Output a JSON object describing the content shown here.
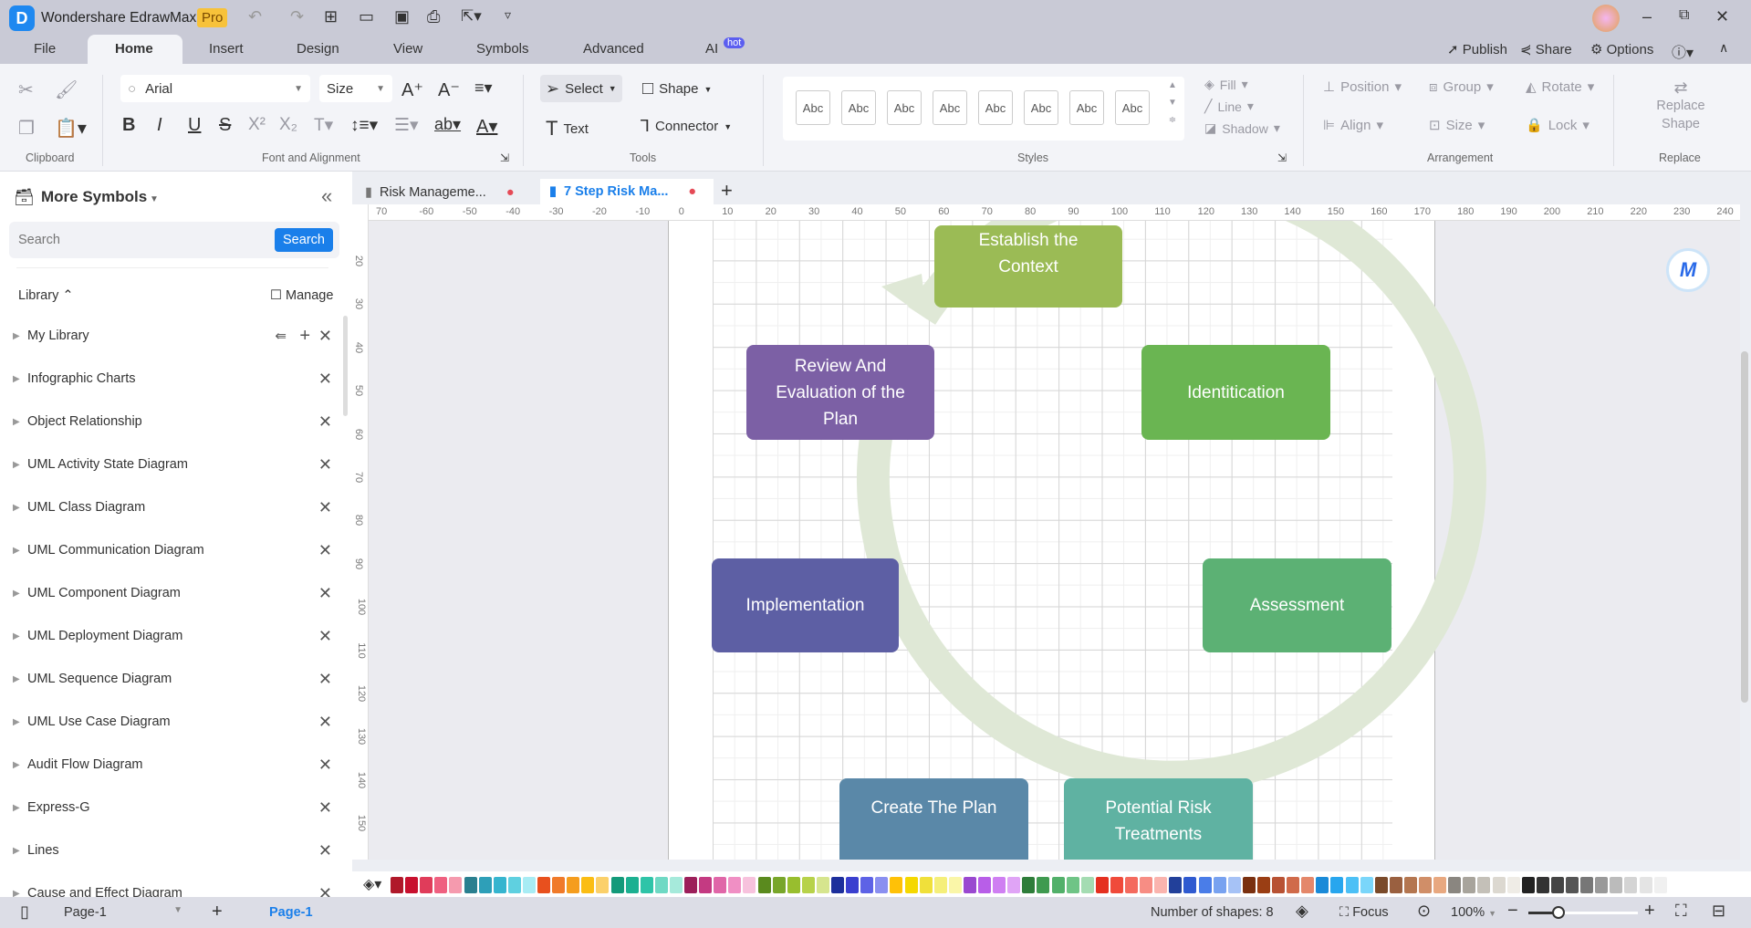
{
  "app": {
    "title": "Wondershare EdrawMax",
    "badge": "Pro",
    "ai_badge": "hot"
  },
  "menu": [
    "File",
    "Home",
    "Insert",
    "Design",
    "View",
    "Symbols",
    "Advanced",
    "AI"
  ],
  "header_actions": {
    "publish": "Publish",
    "share": "Share",
    "options": "Options"
  },
  "ribbon": {
    "font": "Arial",
    "size": "Size",
    "select": "Select",
    "shape": "Shape",
    "text": "Text",
    "connector": "Connector",
    "styles": [
      "Abc",
      "Abc",
      "Abc",
      "Abc",
      "Abc",
      "Abc",
      "Abc",
      "Abc"
    ],
    "fill": "Fill",
    "line": "Line",
    "shadow": "Shadow",
    "position": "Position",
    "group": "Group",
    "rotate": "Rotate",
    "align": "Align",
    "lock": "Lock",
    "replace_shape": "Replace Shape",
    "groups": {
      "clipboard": "Clipboard",
      "font": "Font and Alignment",
      "tools": "Tools",
      "styles": "Styles",
      "arrangement": "Arrangement",
      "replace": "Replace"
    }
  },
  "sidebar": {
    "title": "More Symbols",
    "search_placeholder": "Search",
    "search_button": "Search",
    "library": "Library",
    "manage": "Manage",
    "items": [
      "My Library",
      "Infographic Charts",
      "Object Relationship",
      "UML Activity State Diagram",
      "UML Class Diagram",
      "UML Communication Diagram",
      "UML Component Diagram",
      "UML Deployment Diagram",
      "UML Sequence Diagram",
      "UML Use Case Diagram",
      "Audit Flow Diagram",
      "Express-G",
      "Lines",
      "Cause and Effect Diagram"
    ]
  },
  "doc_tabs": [
    {
      "label": "Risk Manageme...",
      "active": false
    },
    {
      "label": "7 Step Risk Ma...",
      "active": true
    }
  ],
  "rulers": {
    "h": [
      "70",
      "-60",
      "-50",
      "-40",
      "-30",
      "-20",
      "-10",
      "0",
      "10",
      "20",
      "30",
      "40",
      "50",
      "60",
      "70",
      "80",
      "90",
      "100",
      "110",
      "120",
      "130",
      "140",
      "150",
      "160",
      "170",
      "180",
      "190",
      "200",
      "210",
      "220",
      "230",
      "240"
    ],
    "v": [
      "20",
      "30",
      "40",
      "50",
      "60",
      "70",
      "80",
      "90",
      "100",
      "110",
      "120",
      "130",
      "140",
      "150"
    ]
  },
  "diagram": {
    "ring_color": "#dfe8d6",
    "shapes": [
      {
        "id": "establish",
        "label": "Establish the Context",
        "color": "#9bbb55"
      },
      {
        "id": "identification",
        "label": "Identitication",
        "color": "#6ab552"
      },
      {
        "id": "assessment",
        "label": "Assessment",
        "color": "#5cb174"
      },
      {
        "id": "treatments",
        "label": "Potential Risk Treatments",
        "color": "#5fb2a2"
      },
      {
        "id": "create",
        "label": "Create The Plan",
        "color": "#5a88a8"
      },
      {
        "id": "implementation",
        "label": "Implementation",
        "color": "#5d5fa4"
      },
      {
        "id": "review",
        "label": "Review And Evaluation of the Plan",
        "color": "#7c60a5"
      }
    ]
  },
  "palette": [
    "#b0182a",
    "#c8102e",
    "#e03c5a",
    "#ef6080",
    "#f59aae",
    "#2a7f8f",
    "#2e9fb8",
    "#36b5cf",
    "#5fd0e0",
    "#a8ecf4",
    "#e8501e",
    "#f07a2a",
    "#f59d1e",
    "#fbbd14",
    "#fbd06a",
    "#139a7a",
    "#1cb091",
    "#2fc4a8",
    "#6fd9c4",
    "#a6eadb",
    "#9c1f5a",
    "#c43a82",
    "#e066a8",
    "#f08fc4",
    "#f7c2dd",
    "#5a8a1e",
    "#78a62a",
    "#98be2e",
    "#b7d24a",
    "#d6e58e",
    "#1d2f9c",
    "#3a3fcf",
    "#5d62e6",
    "#8a8ff0",
    "#ffc107",
    "#f5d800",
    "#f0e03a",
    "#f5ef7a",
    "#faf6a8",
    "#9a48d0",
    "#b85ee8",
    "#cf7ff2",
    "#e0a4f6",
    "#2e7d3a",
    "#3f9a50",
    "#52b06a",
    "#6fc486",
    "#a4dcb2",
    "#e53020",
    "#f04a3a",
    "#f46a5e",
    "#f78d84",
    "#fab4ae",
    "#22409a",
    "#2f5ad0",
    "#4a7de8",
    "#78a2f0",
    "#a6c2f6",
    "#7a3010",
    "#9a3e14",
    "#b85234",
    "#d06a4a",
    "#e4876a",
    "#1a8ad8",
    "#28a6ee",
    "#4cc0f6",
    "#7ad6fa",
    "#7a4a2a",
    "#9a6040",
    "#b47650",
    "#d08e68",
    "#e8a880",
    "#8a8680",
    "#a8a49c",
    "#c4c0b8",
    "#dcd8d0",
    "#efece6",
    "#222222",
    "#333333",
    "#444444",
    "#555555",
    "#777777",
    "#999999",
    "#bbbbbb",
    "#d4d4d4",
    "#e4e4e4",
    "#f0f0f0"
  ],
  "status": {
    "page_select": "Page-1",
    "page_tab": "Page-1",
    "shapes": "Number of shapes: 8",
    "focus": "Focus",
    "zoom": "100%"
  }
}
